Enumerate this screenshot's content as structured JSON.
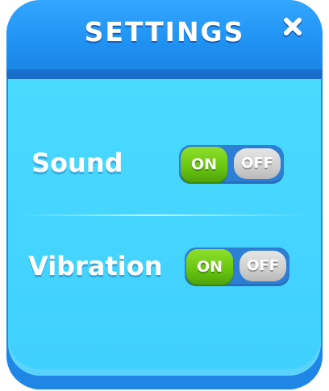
{
  "dialog": {
    "title": "SETTINGS",
    "close_icon": "close-icon"
  },
  "settings": [
    {
      "label": "Sound",
      "on_label": "ON",
      "off_label": "OFF",
      "state": "on"
    },
    {
      "label": "Vibration",
      "on_label": "ON",
      "off_label": "OFF",
      "state": "on"
    }
  ],
  "colors": {
    "header_blue": "#1f91f2",
    "body_cyan": "#44d4ff",
    "on_green": "#68c410",
    "off_grey": "#cfcfcf",
    "track_blue": "#2d7fd6"
  }
}
